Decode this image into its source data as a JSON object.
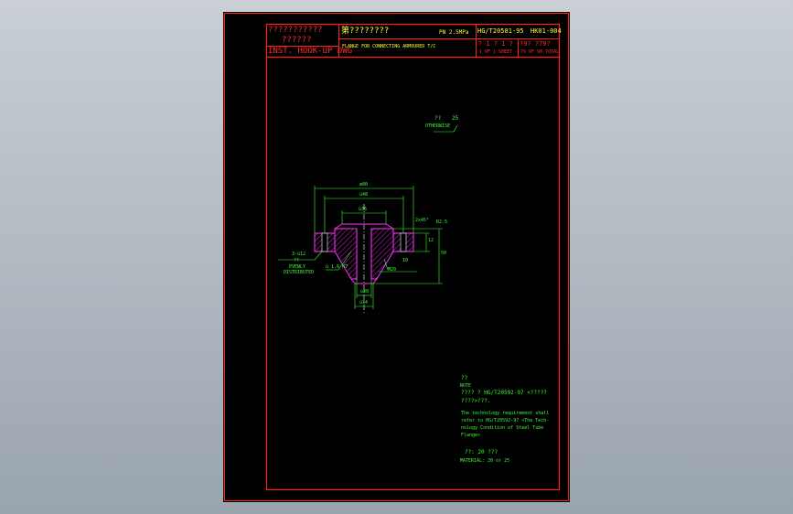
{
  "titleblock": {
    "cn_title_1": "???????????",
    "cn_title_2": "??????",
    "en_title": "INST. HOOK-UP DWG",
    "part_cn": "第????????",
    "pressure": "PN 2.5MPa",
    "part_en": "FLANGE FOR CONNECTING ARMOURED T/C",
    "standard": "HG/T20581-95",
    "dwg_no": "HK01-004",
    "sheet_cn": "? 1 ? 1 ?",
    "sheet_en": "1 OF 1 SHEET",
    "total_cn": "?9? ?79?",
    "total_en": "79 OF 98 TOTAL"
  },
  "drawing": {
    "surface_sym": "??",
    "surface_val": "25",
    "surface_en": "OTHERWISE",
    "dim_outer": "ø80",
    "dim_bolt": "ù48",
    "dim_hub": "ù36",
    "dim_bore_top": "ù40",
    "dim_bore_bot": "ù34",
    "dim_thk": "12",
    "dim_height": "50",
    "dim_r": "R2.5",
    "dim_chamfer": "2x45°",
    "dim_holes_cn": "??",
    "dim_holes_en1": "EVENLY",
    "dim_holes_en2": "DISTRIBUTED",
    "dim_hole_size": "3-ù12",
    "dim_bolt_circle": "ù 1.6 H7",
    "dim_small": "10",
    "dim_m": "M20"
  },
  "notes": {
    "title_cn": "??",
    "title_en": "NOTE",
    "cn_line1": "????  ? HG/T20592-97 <????? ",
    "cn_line2": "????>???.",
    "en_line1": "The technology requirement shall",
    "en_line2": "refer to HG/T20592-97 <The Tech-",
    "en_line3": "nology Condition of Steel Tube",
    "en_line4": "Flange>",
    "mat_cn": "??: 20 ???",
    "mat_en": "MATERIAL: 20 or 25"
  }
}
